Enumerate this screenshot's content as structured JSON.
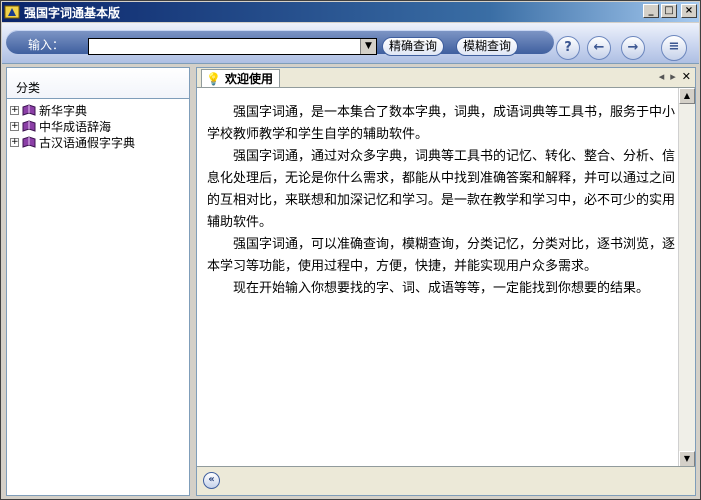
{
  "window": {
    "title": "强国字词通基本版"
  },
  "toolbar": {
    "input_label": "输入：",
    "search_value": "",
    "exact_search": "精确查询",
    "fuzzy_search": "模糊查询"
  },
  "sidebar": {
    "header": "分类",
    "items": [
      {
        "label": "新华字典"
      },
      {
        "label": "中华成语辞海"
      },
      {
        "label": "古汉语通假字字典"
      }
    ]
  },
  "main": {
    "tab_label": "欢迎使用",
    "paragraphs": [
      "强国字词通，是一本集合了数本字典，词典，成语词典等工具书，服务于中小学校教师教学和学生自学的辅助软件。",
      "强国字词通，通过对众多字典，词典等工具书的记忆、转化、整合、分析、信息化处理后，无论是你什么需求，都能从中找到准确答案和解释，并可以通过之间的互相对比，来联想和加深记忆和学习。是一款在教学和学习中，必不可少的实用辅助软件。",
      "强国字词通，可以准确查询，模糊查询，分类记忆，分类对比，逐书浏览，逐本学习等功能，使用过程中，方便，快捷，并能实现用户众多需求。",
      "现在开始输入你想要找的字、词、成语等等，一定能找到你想要的结果。"
    ]
  },
  "icons": {
    "help": "help-icon",
    "back": "arrow-left-icon",
    "forward": "arrow-right-icon",
    "book": "book-icon",
    "colors": {
      "accent": "#0a246a",
      "toolbar": "#c7d3ee"
    }
  }
}
